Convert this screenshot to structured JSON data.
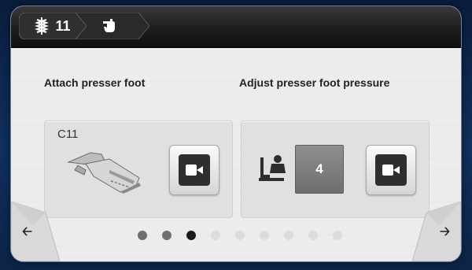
{
  "breadcrumb": [
    {
      "icon": "stitch-icon",
      "label": "11"
    },
    {
      "icon": "hand-pointer-icon",
      "label": ""
    }
  ],
  "steps": {
    "left": {
      "heading": "Attach presser foot",
      "foot_code": "C11",
      "image_icon": "presser-foot-image",
      "video_icon": "video-camera-icon"
    },
    "right": {
      "heading": "Adjust presser foot pressure",
      "pressure_icon": "presser-foot-pressure-icon",
      "pressure_value": "4",
      "video_icon": "video-camera-icon"
    }
  },
  "pagination": {
    "total": 9,
    "current": 3
  },
  "navigation": {
    "prev_icon": "arrow-left-icon",
    "next_icon": "arrow-right-icon"
  }
}
